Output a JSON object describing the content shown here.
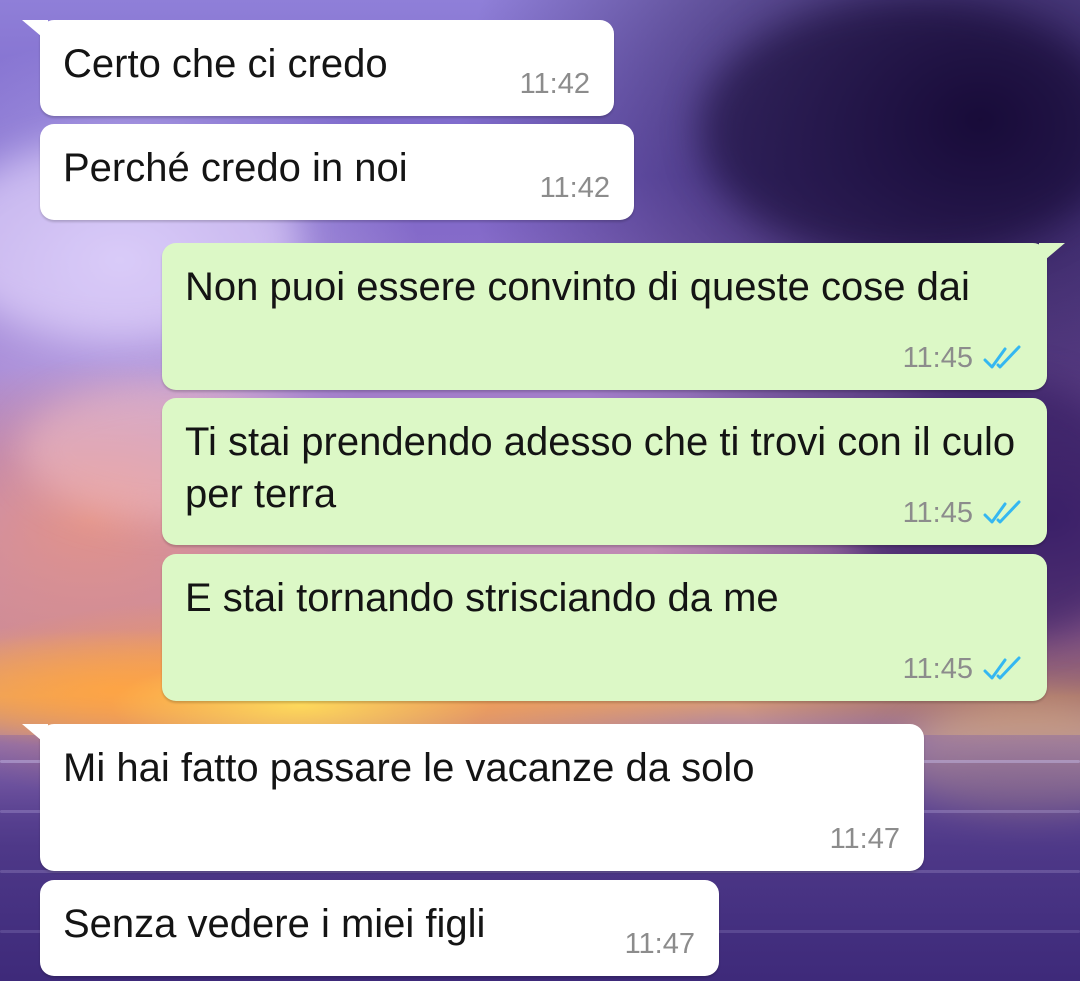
{
  "colors": {
    "incoming_bubble": "#ffffff",
    "outgoing_bubble": "#dcf8c6",
    "message_text": "#141414",
    "timestamp": "#8c8c8c",
    "read_ticks": "#34b7f1"
  },
  "messages": [
    {
      "direction": "incoming",
      "text": "Certo che ci credo",
      "time": "11:42"
    },
    {
      "direction": "incoming",
      "text": "Perché credo in noi",
      "time": "11:42"
    },
    {
      "direction": "outgoing",
      "text": "Non puoi essere convinto di queste cose dai",
      "time": "11:45",
      "status_icon": "double-check-read-icon"
    },
    {
      "direction": "outgoing",
      "text": "Ti stai prendendo adesso che ti trovi con il culo per terra",
      "time": "11:45",
      "status_icon": "double-check-read-icon"
    },
    {
      "direction": "outgoing",
      "text": "E stai tornando strisciando da me",
      "time": "11:45",
      "status_icon": "double-check-read-icon"
    },
    {
      "direction": "incoming",
      "text": "Mi hai fatto passare le vacanze da solo",
      "time": "11:47"
    },
    {
      "direction": "incoming",
      "text": "Senza vedere i miei figli",
      "time": "11:47"
    }
  ]
}
